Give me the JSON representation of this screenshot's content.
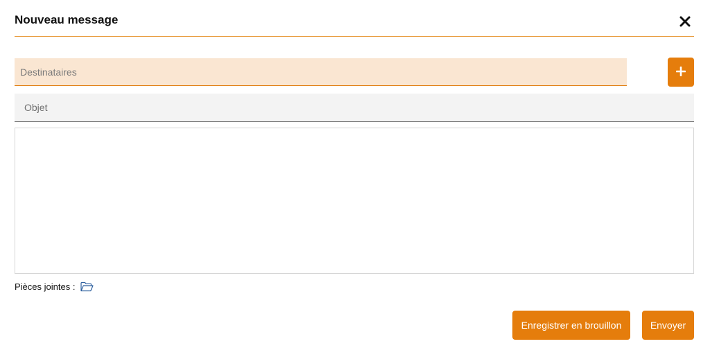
{
  "dialog": {
    "title": "Nouveau message"
  },
  "recipients": {
    "placeholder": "Destinataires",
    "value": ""
  },
  "subject": {
    "placeholder": "Objet",
    "value": ""
  },
  "message_body": {
    "value": ""
  },
  "attachments": {
    "label": "Pièces jointes :"
  },
  "actions": {
    "save_draft_label": "Enregistrer en brouillon",
    "send_label": "Envoyer"
  },
  "icons": {
    "close": "close-icon",
    "add": "plus-icon",
    "attachments": "folder-icon"
  },
  "colors": {
    "accent": "#e57d0c",
    "recipients_bg": "#fae6d2",
    "subject_bg": "#f3f3f3",
    "header_rule": "#e89a3a"
  }
}
